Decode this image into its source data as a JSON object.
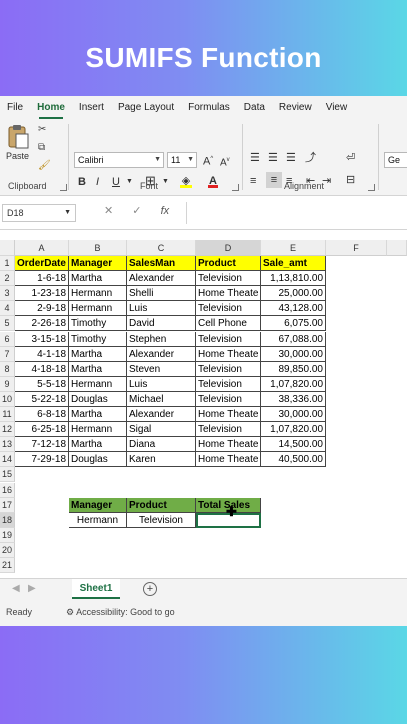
{
  "title": "SUMIFS Function",
  "menu": [
    "File",
    "Home",
    "Insert",
    "Page Layout",
    "Formulas",
    "Data",
    "Review",
    "View"
  ],
  "ribbon": {
    "clipboard_label": "Clipboard",
    "paste_label": "Paste",
    "font_label": "Font",
    "alignment_label": "Alignment",
    "font_name": "Calibri",
    "font_size": "11",
    "number_format": "Ge"
  },
  "formula_bar": {
    "name_box": "D18",
    "fx": "fx"
  },
  "columns": [
    "A",
    "B",
    "C",
    "D",
    "E",
    "F"
  ],
  "rows": [
    "1",
    "2",
    "3",
    "4",
    "5",
    "6",
    "7",
    "8",
    "9",
    "10",
    "11",
    "12",
    "13",
    "14",
    "15",
    "16",
    "17",
    "18",
    "19",
    "20",
    "21"
  ],
  "table": {
    "headers": [
      "OrderDate",
      "Manager",
      "SalesMan",
      "Product",
      "Sale_amt"
    ],
    "rows": [
      [
        "1-6-18",
        "Martha",
        "Alexander",
        "Television",
        "1,13,810.00"
      ],
      [
        "1-23-18",
        "Hermann",
        "Shelli",
        "Home Theate",
        "25,000.00"
      ],
      [
        "2-9-18",
        "Hermann",
        "Luis",
        "Television",
        "43,128.00"
      ],
      [
        "2-26-18",
        "Timothy",
        "David",
        "Cell Phone",
        "6,075.00"
      ],
      [
        "3-15-18",
        "Timothy",
        "Stephen",
        "Television",
        "67,088.00"
      ],
      [
        "4-1-18",
        "Martha",
        "Alexander",
        "Home Theate",
        "30,000.00"
      ],
      [
        "4-18-18",
        "Martha",
        "Steven",
        "Television",
        "89,850.00"
      ],
      [
        "5-5-18",
        "Hermann",
        "Luis",
        "Television",
        "1,07,820.00"
      ],
      [
        "5-22-18",
        "Douglas",
        "Michael",
        "Television",
        "38,336.00"
      ],
      [
        "6-8-18",
        "Martha",
        "Alexander",
        "Home Theate",
        "30,000.00"
      ],
      [
        "6-25-18",
        "Hermann",
        "Sigal",
        "Television",
        "1,07,820.00"
      ],
      [
        "7-12-18",
        "Martha",
        "Diana",
        "Home Theate",
        "14,500.00"
      ],
      [
        "7-29-18",
        "Douglas",
        "Karen",
        "Home Theate",
        "40,500.00"
      ]
    ]
  },
  "criteria": {
    "headers": [
      "Manager",
      "Product",
      "Total Sales"
    ],
    "values": [
      "Hermann",
      "Television",
      ""
    ]
  },
  "sheet_tab": "Sheet1",
  "status": {
    "ready": "Ready",
    "accessibility": "Accessibility: Good to go"
  },
  "colors": {
    "header_yellow": "#ffff00",
    "criteria_green": "#70ad47",
    "excel_green": "#1e7145"
  }
}
